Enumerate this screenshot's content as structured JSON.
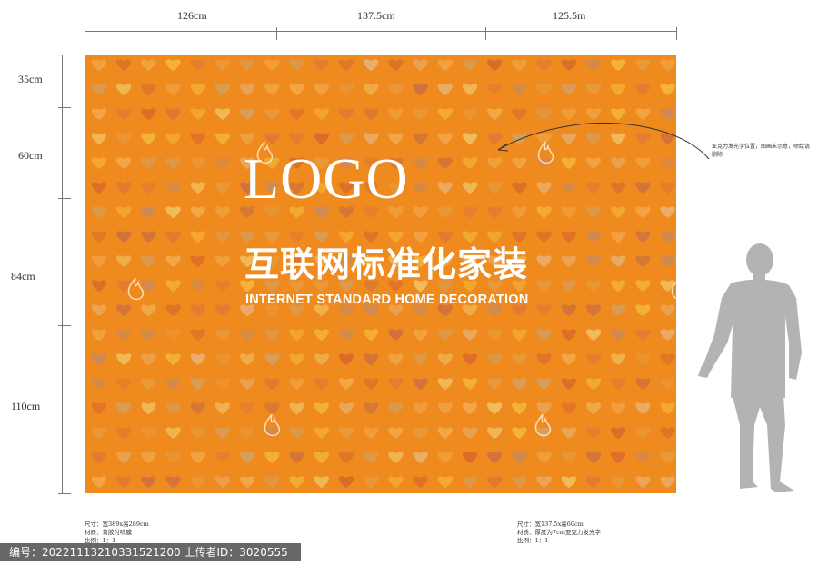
{
  "dimensions": {
    "top": [
      "126cm",
      "137.5cm",
      "125.5m"
    ],
    "left": [
      "35cm",
      "60cm",
      "84cm",
      "110cm"
    ]
  },
  "board": {
    "logo": "LOGO",
    "title_cn": "互联网标准化家装",
    "title_en": "INTERNET STANDARD HOME DECORATION",
    "background_color": "#ee8a1e"
  },
  "note": "亚克力发光字位置，图画未示意，喷绘请删除",
  "spec_left": [
    "尺寸：宽389x高289cm",
    "材质：背胶付喷膜",
    "比例：1：1"
  ],
  "spec_right": [
    "尺寸：宽137.5x高60cm",
    "材质：厚度为7cm亚克力发光字",
    "比例：1：1"
  ],
  "watermark": {
    "text": "编号：20221113210331521200 上传者ID：3020555"
  },
  "icons": {
    "pattern": "heart-pattern",
    "person": "person-silhouette-icon",
    "arrow": "curved-arrow-icon"
  }
}
